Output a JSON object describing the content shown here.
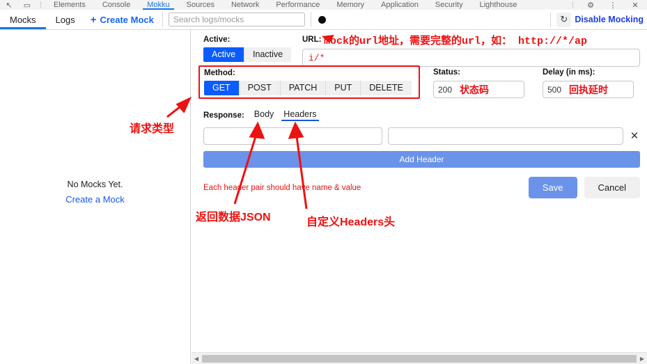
{
  "devtools": {
    "icons": [
      {
        "name": "inspect-element-icon",
        "glyph": "↖"
      },
      {
        "name": "device-toolbar-icon",
        "glyph": "▭"
      }
    ],
    "tabs": [
      {
        "label": "Elements",
        "active": false
      },
      {
        "label": "Console",
        "active": false
      },
      {
        "label": "Mokku",
        "active": true
      },
      {
        "label": "Sources",
        "active": false
      },
      {
        "label": "Network",
        "active": false
      },
      {
        "label": "Performance",
        "active": false
      },
      {
        "label": "Memory",
        "active": false
      },
      {
        "label": "Application",
        "active": false
      },
      {
        "label": "Security",
        "active": false
      },
      {
        "label": "Lighthouse",
        "active": false
      }
    ],
    "right_icons": [
      {
        "name": "settings-gear-icon",
        "glyph": "⚙"
      },
      {
        "name": "more-options-icon",
        "glyph": "⋮"
      },
      {
        "name": "close-devtools-icon",
        "glyph": "✕"
      }
    ]
  },
  "toolbar": {
    "tab_mocks": "Mocks",
    "tab_logs": "Logs",
    "create_mock": "Create Mock",
    "create_mock_plus": "+",
    "search_placeholder": "Search logs/mocks",
    "search_value": "",
    "record_icon": "record-dot-icon",
    "refresh_icon": "↻",
    "disable_mocking": "Disable Mocking"
  },
  "sidebar": {
    "empty_title": "No Mocks Yet.",
    "empty_link": "Create a Mock"
  },
  "form": {
    "active_label": "Active:",
    "active_options": [
      "Active",
      "Inactive"
    ],
    "active_selected": "Active",
    "url_label": "URL:",
    "url_value": "i/*",
    "method_label": "Method:",
    "method_options": [
      "GET",
      "POST",
      "PATCH",
      "PUT",
      "DELETE"
    ],
    "method_selected": "GET",
    "status_label": "Status:",
    "status_value": "200",
    "status_note": "状态码",
    "delay_label": "Delay (in ms):",
    "delay_value": "500",
    "delay_note": "回执延时",
    "response_label": "Response:",
    "response_tabs": [
      "Body",
      "Headers"
    ],
    "response_selected": "Headers",
    "header_name_value": "",
    "header_value_value": "",
    "header_remove_icon": "✕",
    "add_header": "Add Header",
    "hint": "Each header pair should have name & value",
    "save": "Save",
    "cancel": "Cancel"
  },
  "annotations": {
    "url": "mock的url地址，需要完整的url，如： http://*/ap",
    "request_type": "请求类型",
    "response_json": "返回数据JSON",
    "custom_headers": "自定义Headers头"
  },
  "scrollbar": {
    "left_arrow": "◀",
    "right_arrow": "▶"
  },
  "colors": {
    "accent_blue": "#0b5cff",
    "link_blue": "#1a56e8",
    "button_blue": "#6b93ea",
    "annotation_red": "#ee1111"
  }
}
